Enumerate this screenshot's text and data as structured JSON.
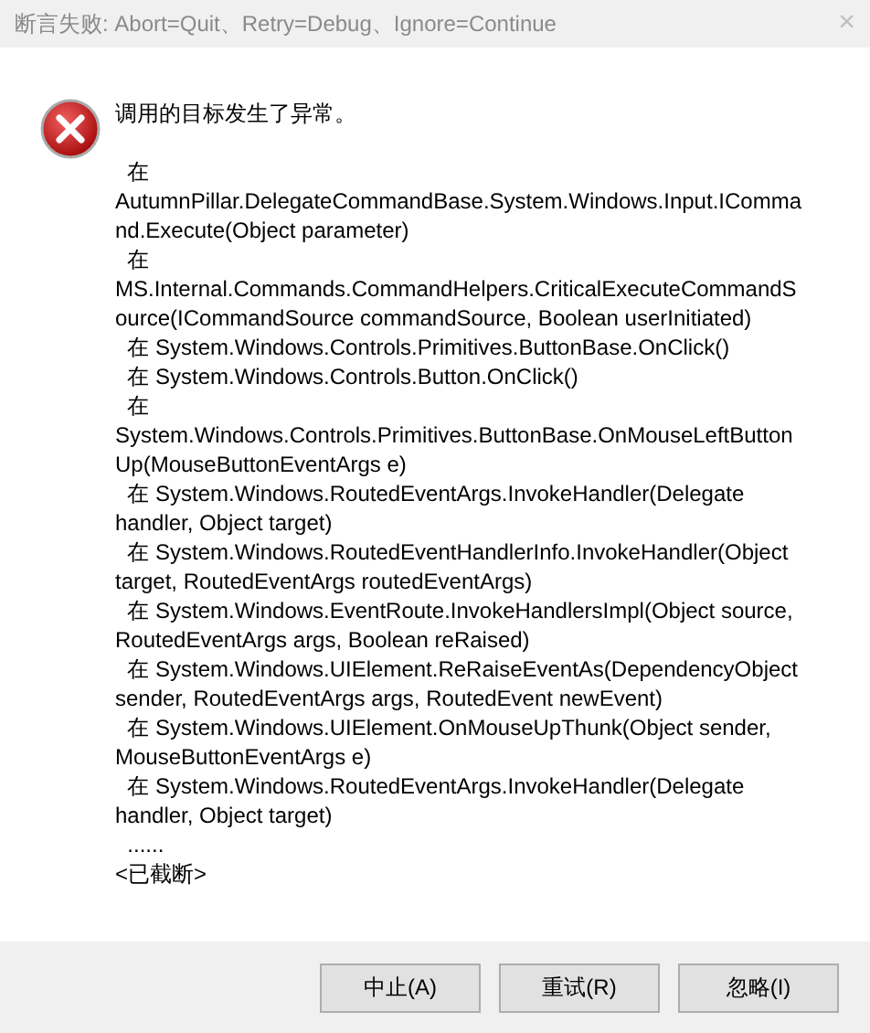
{
  "window": {
    "title": "断言失败: Abort=Quit、Retry=Debug、Ignore=Continue",
    "close": "×"
  },
  "message": {
    "heading": "调用的目标发生了异常。",
    "frames": [
      "  在 AutumnPillar.DelegateCommandBase.System.Windows.Input.ICommand.Execute(Object parameter)",
      "  在 MS.Internal.Commands.CommandHelpers.CriticalExecuteCommandSource(ICommandSource commandSource, Boolean userInitiated)",
      "  在 System.Windows.Controls.Primitives.ButtonBase.OnClick()",
      "  在 System.Windows.Controls.Button.OnClick()",
      "  在 System.Windows.Controls.Primitives.ButtonBase.OnMouseLeftButtonUp(MouseButtonEventArgs e)",
      "  在 System.Windows.RoutedEventArgs.InvokeHandler(Delegate handler, Object target)",
      "  在 System.Windows.RoutedEventHandlerInfo.InvokeHandler(Object target, RoutedEventArgs routedEventArgs)",
      "  在 System.Windows.EventRoute.InvokeHandlersImpl(Object source, RoutedEventArgs args, Boolean reRaised)",
      "  在 System.Windows.UIElement.ReRaiseEventAs(DependencyObject sender, RoutedEventArgs args, RoutedEvent newEvent)",
      "  在 System.Windows.UIElement.OnMouseUpThunk(Object sender, MouseButtonEventArgs e)",
      "  在 System.Windows.RoutedEventArgs.InvokeHandler(Delegate handler, Object target)",
      "  ......"
    ],
    "truncated": "<已截断>"
  },
  "buttons": [
    "中止(A)",
    "重试(R)",
    "忽略(I)"
  ]
}
